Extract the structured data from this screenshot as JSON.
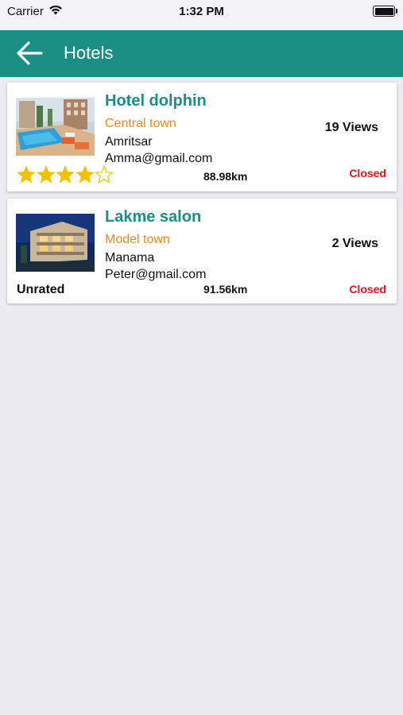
{
  "status_bar": {
    "carrier": "Carrier",
    "time": "1:32 PM"
  },
  "nav": {
    "title": "Hotels"
  },
  "hotels": [
    {
      "name": "Hotel dolphin",
      "town": "Central town",
      "city": "Amritsar",
      "email": "Amma@gmail.com",
      "views": "19 Views",
      "distance": "88.98km",
      "status": "Closed",
      "rating": 4,
      "rating_max": 5
    },
    {
      "name": "Lakme salon",
      "town": "Model town",
      "city": "Manama",
      "email": "Peter@gmail.com",
      "views": "2 Views",
      "distance": "91.56km",
      "status": "Closed",
      "rating_label": "Unrated"
    }
  ],
  "colors": {
    "accent": "#1b8f83",
    "town": "#f08a1c",
    "closed": "#e3121c",
    "star": "#f2c200"
  },
  "icons": [
    "wifi-icon",
    "battery-icon",
    "back-arrow-icon",
    "star-icon"
  ]
}
